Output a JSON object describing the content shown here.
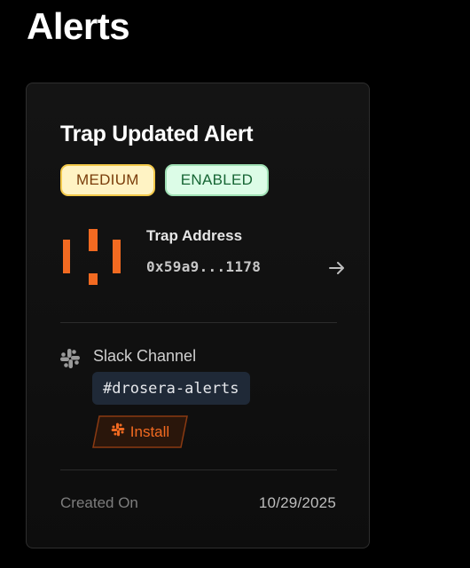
{
  "page": {
    "title": "Alerts"
  },
  "alert_card": {
    "title": "Trap Updated Alert",
    "badges": {
      "severity": "MEDIUM",
      "status": "ENABLED"
    },
    "trap": {
      "label": "Trap Address",
      "address": "0x59a9...1178",
      "logo_icon": "drosera-trap-logo",
      "link_icon": "arrow-right-icon"
    },
    "slack": {
      "label": "Slack Channel",
      "channel": "#drosera-alerts",
      "icon": "slack-icon",
      "install_label": "Install"
    },
    "created": {
      "label": "Created On",
      "value": "10/29/2025"
    }
  },
  "colors": {
    "background": "#000000",
    "card": "#111111",
    "accent_orange": "#f26a21",
    "medium_bg": "#fff3c4",
    "medium_text": "#7a3d0a",
    "enabled_bg": "#dcfce7",
    "enabled_text": "#166534"
  }
}
